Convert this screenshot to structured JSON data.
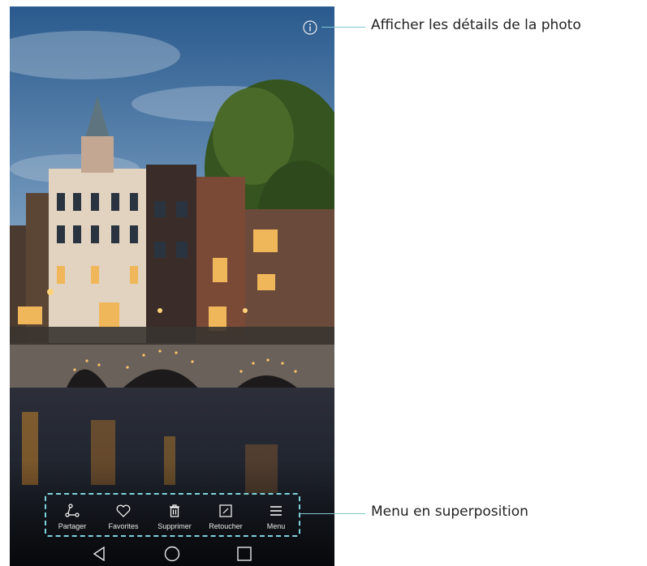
{
  "info_icon": "info-icon",
  "overlay_menu": {
    "items": [
      {
        "label": "Partager",
        "icon": "share-icon"
      },
      {
        "label": "Favorites",
        "icon": "heart-icon"
      },
      {
        "label": "Supprimer",
        "icon": "trash-icon"
      },
      {
        "label": "Retoucher",
        "icon": "edit-icon"
      },
      {
        "label": "Menu",
        "icon": "menu-icon"
      }
    ],
    "border_color": "#7fd3dc"
  },
  "nav": {
    "back": "back-icon",
    "home": "home-icon",
    "recents": "recents-icon"
  },
  "callouts": {
    "details": "Afficher les détails de la photo",
    "menu": "Menu en superposition"
  },
  "callout_color": "#7fc7cf"
}
